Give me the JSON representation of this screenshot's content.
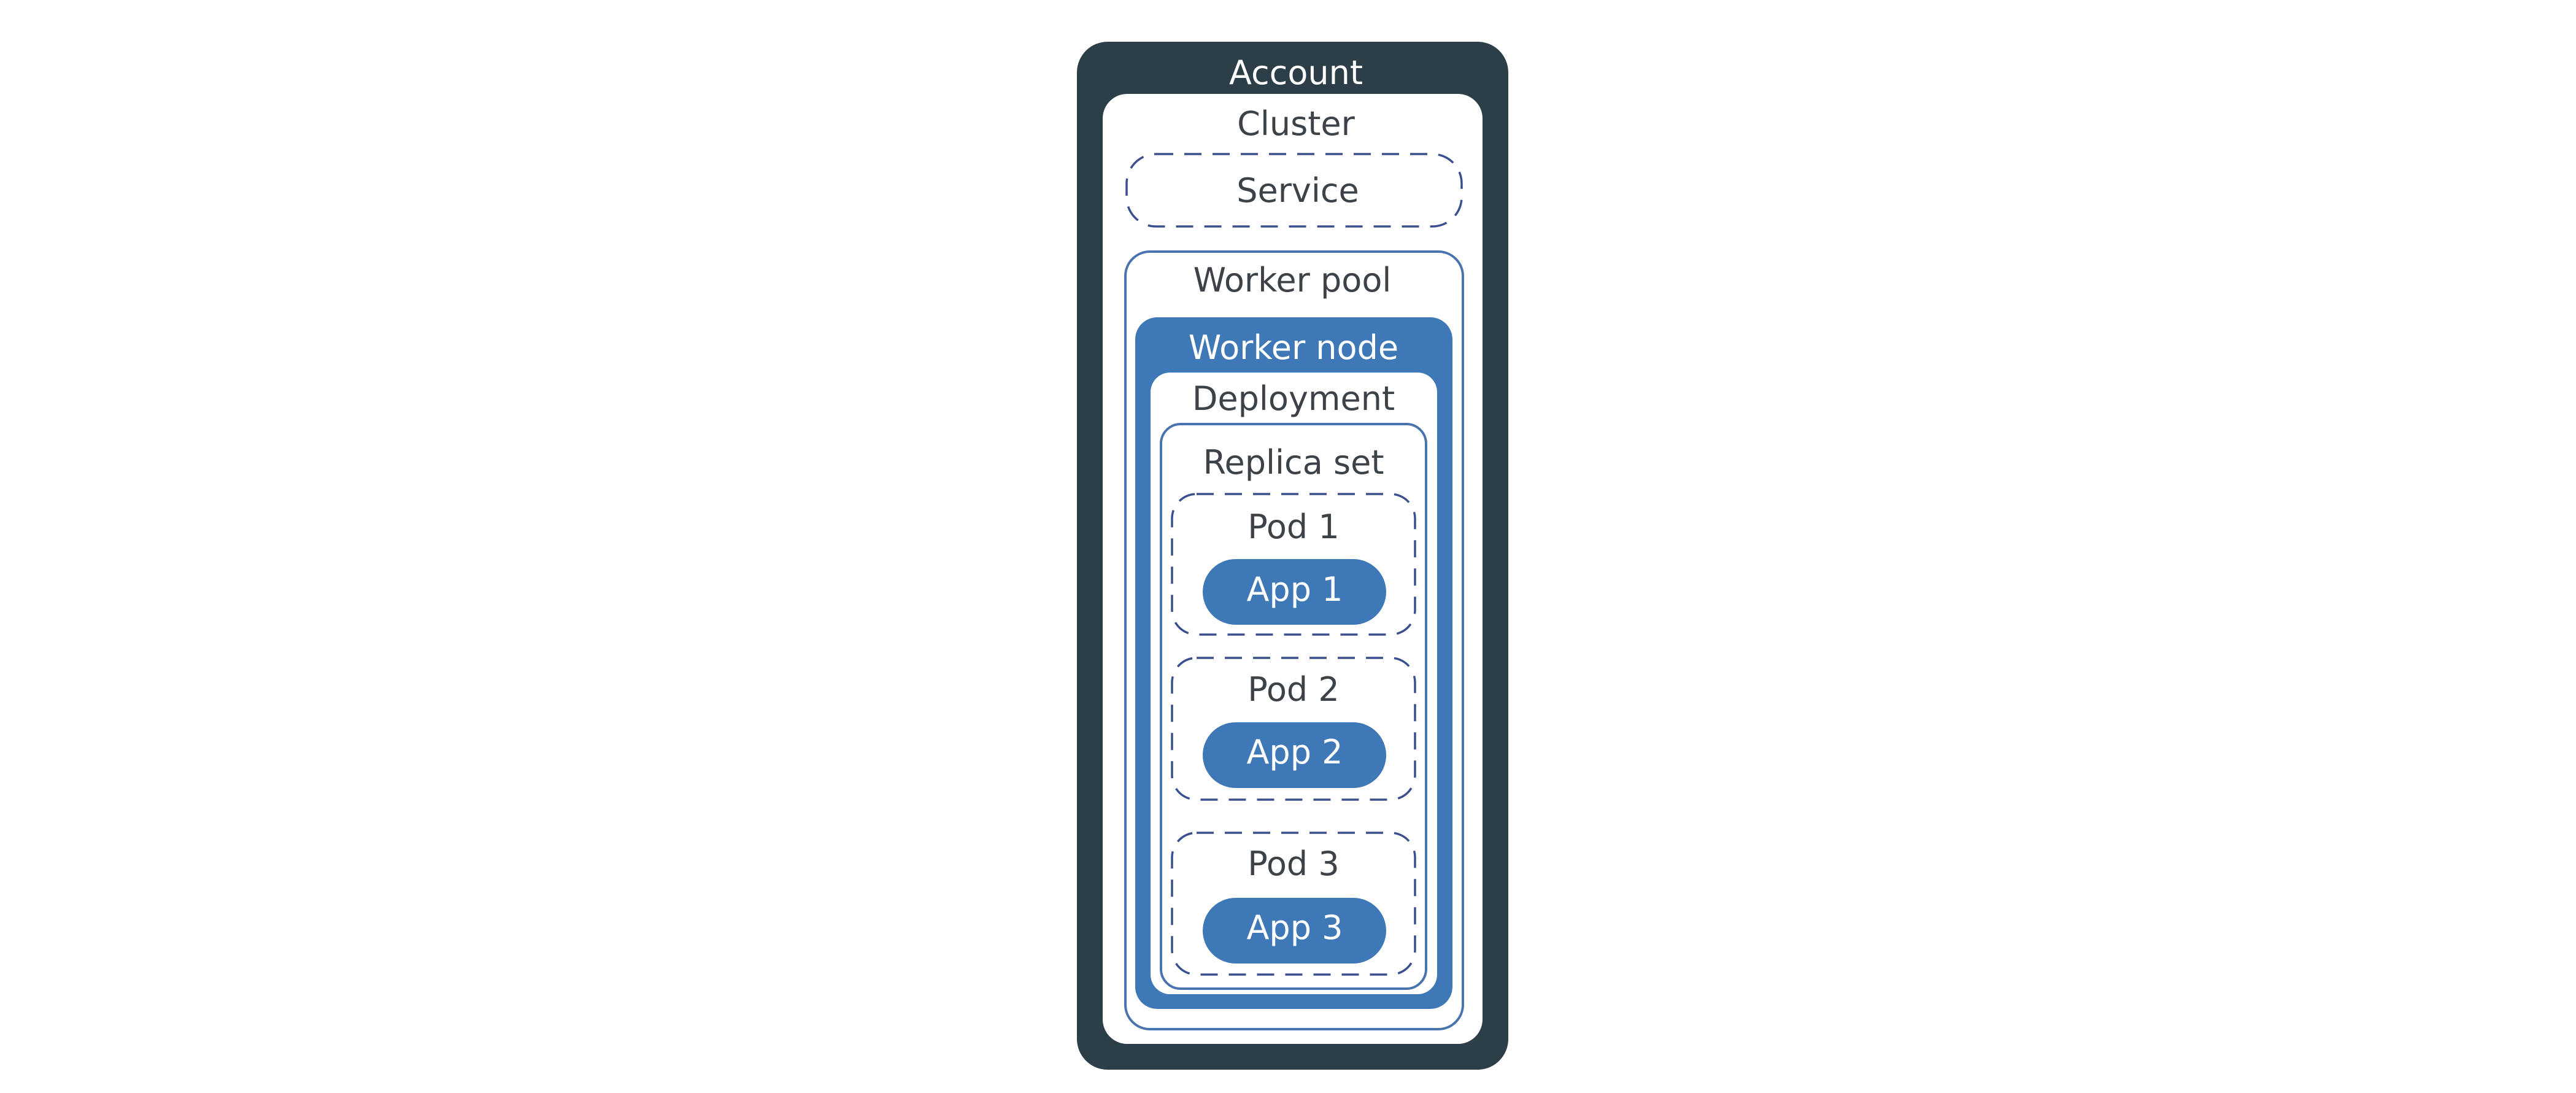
{
  "colors": {
    "account_fill": "#2c3e48",
    "worker_node_fill": "#3f78b7",
    "app_fill": "#3f78b7",
    "outline": "#4a74ae",
    "dash": "#3b4f8f",
    "dark_text": "#3d4148",
    "light_text": "#ffffff",
    "panel_fill": "#ffffff"
  },
  "labels": {
    "account": "Account",
    "cluster": "Cluster",
    "service": "Service",
    "worker_pool": "Worker pool",
    "worker_node": "Worker node",
    "deployment": "Deployment",
    "replica_set": "Replica set"
  },
  "pods": [
    {
      "label": "Pod 1",
      "app": "App 1"
    },
    {
      "label": "Pod 2",
      "app": "App 2"
    },
    {
      "label": "Pod 3",
      "app": "App 3"
    }
  ]
}
